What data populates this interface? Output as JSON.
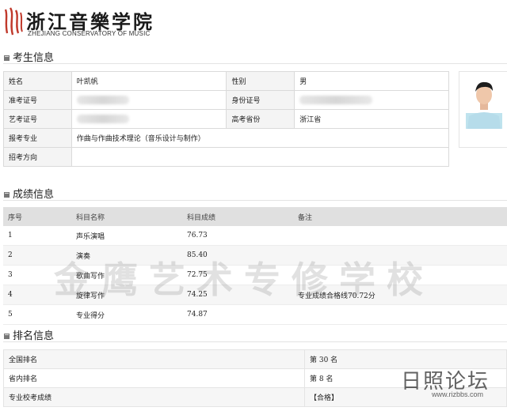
{
  "header": {
    "logo_cn": "浙江音樂学院",
    "logo_en": "ZHEJIANG CONSERVATORY OF MUSIC"
  },
  "colors": {
    "brand_red": "#c0392b",
    "header_bg": "#e0e0e0",
    "row_alt": "#f6f6f6"
  },
  "icons": {
    "section": "book-icon",
    "logo": "school-logo-icon"
  },
  "student_section": {
    "title": "考生信息",
    "rows": [
      [
        {
          "label": "姓名",
          "value": "叶凯帆"
        },
        {
          "label": "性别",
          "value": "男"
        }
      ],
      [
        {
          "label": "准考证号",
          "value": ""
        },
        {
          "label": "身份证号",
          "value": ""
        }
      ],
      [
        {
          "label": "艺考证号",
          "value": ""
        },
        {
          "label": "高考省份",
          "value": "浙江省"
        }
      ]
    ],
    "major_label": "报考专业",
    "major_value": "作曲与作曲技术理论（音乐设计与制作）",
    "direction_label": "招考方向",
    "direction_value": ""
  },
  "score_section": {
    "title": "成绩信息",
    "columns": [
      "序号",
      "科目名称",
      "科目成绩",
      "备注"
    ],
    "rows": [
      {
        "no": "1",
        "subject": "声乐演唱",
        "score": "76.73",
        "note": ""
      },
      {
        "no": "2",
        "subject": "演奏",
        "score": "85.40",
        "note": ""
      },
      {
        "no": "3",
        "subject": "歌曲写作",
        "score": "72.75",
        "note": ""
      },
      {
        "no": "4",
        "subject": "旋律写作",
        "score": "74.25",
        "note": "专业成绩合格线70.72分"
      },
      {
        "no": "5",
        "subject": "专业得分",
        "score": "74.87",
        "note": ""
      }
    ]
  },
  "rank_section": {
    "title": "排名信息",
    "rows": [
      {
        "label": "全国排名",
        "value": "第 30 名"
      },
      {
        "label": "省内排名",
        "value": "第 8 名"
      },
      {
        "label": "专业校考成绩",
        "value": "【合格】"
      }
    ]
  },
  "watermark": "金鹰艺术专修学校",
  "corner_watermark": {
    "cn": "日照论坛",
    "en": "www.rizbbs.com"
  }
}
